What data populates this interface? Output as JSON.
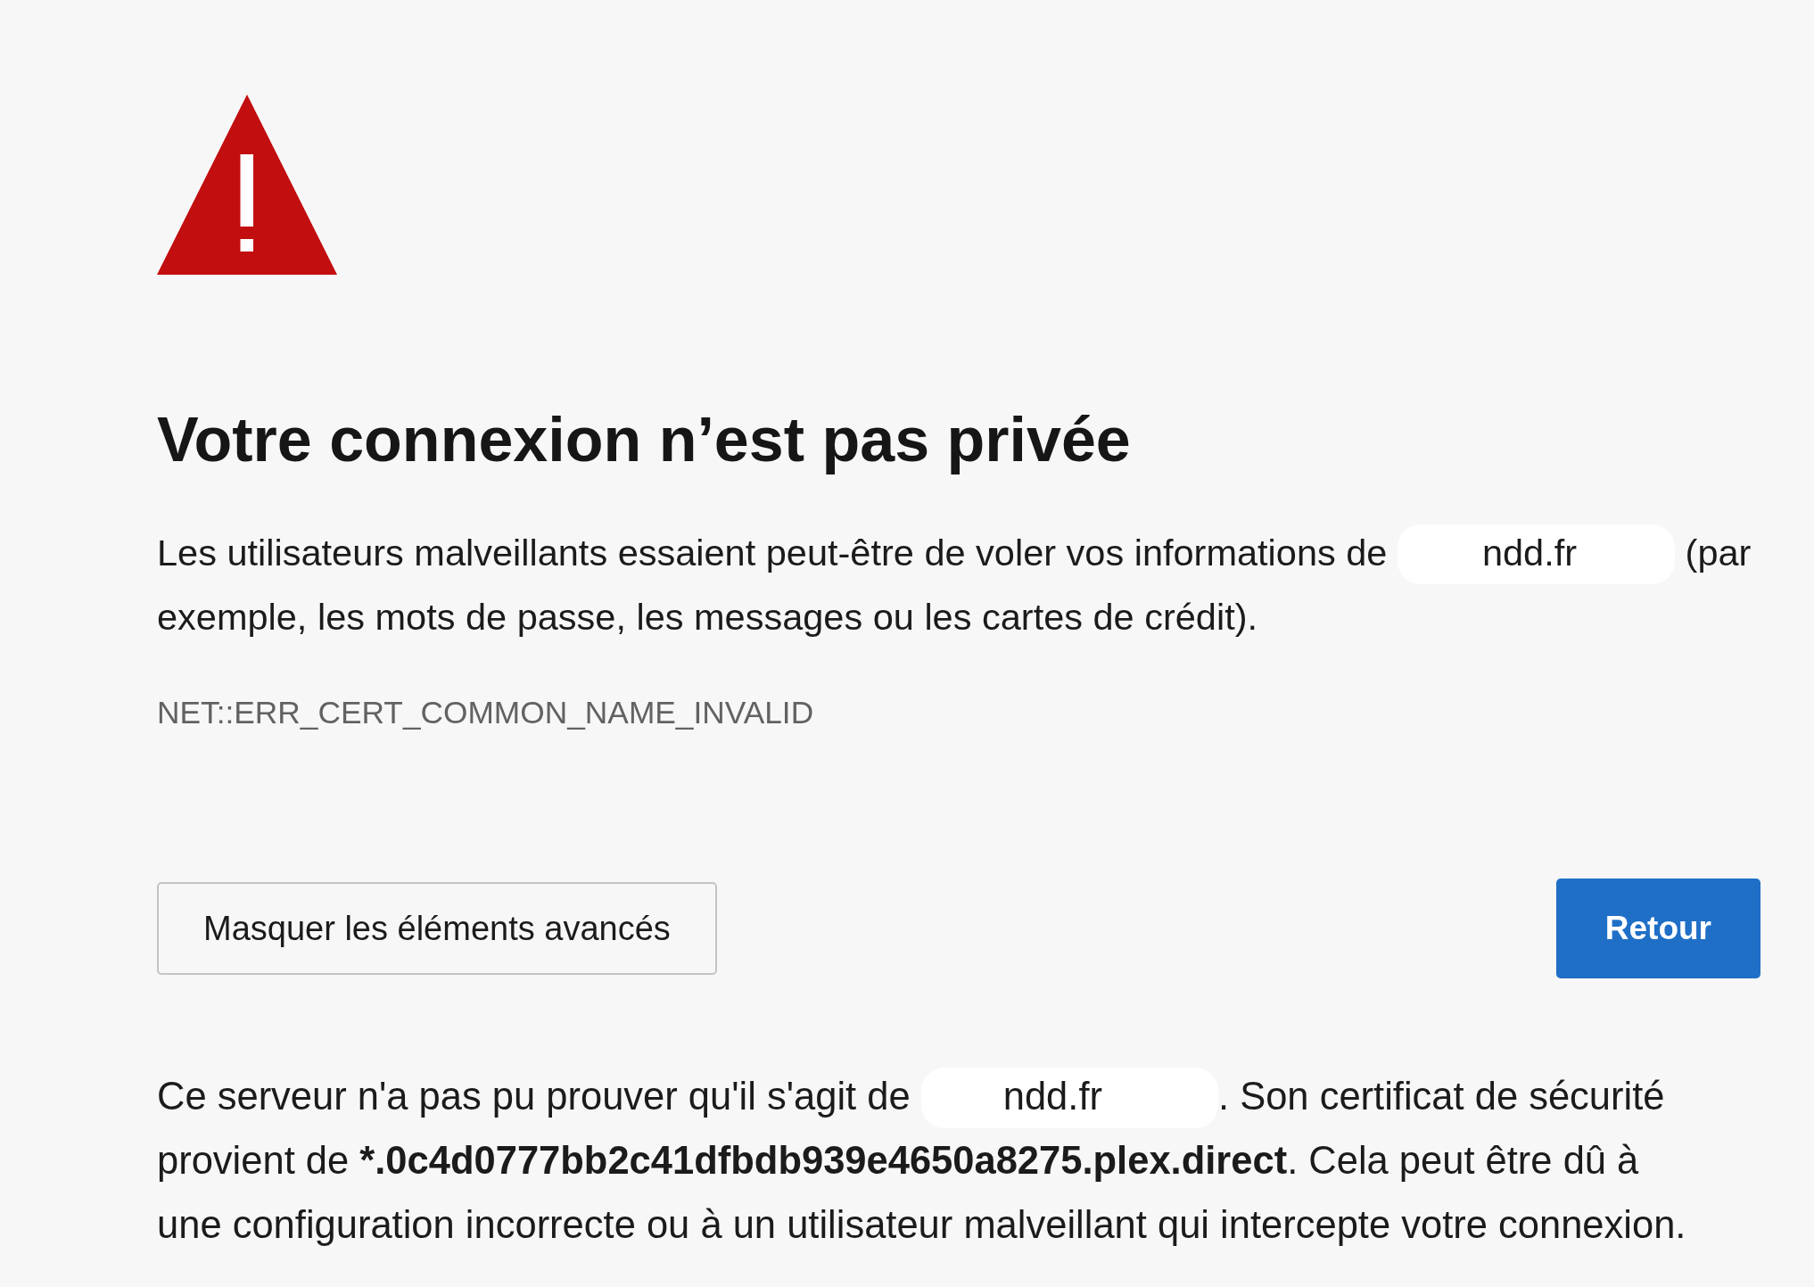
{
  "heading": "Votre connexion n’est pas privée",
  "intro": [
    {
      "kind": "plain",
      "text": "Les utilisateurs malveillants essaient peut-être de voler vos informations de "
    },
    {
      "kind": "redacted",
      "text": "ndd.fr"
    },
    {
      "kind": "plain",
      "text": " (par exemple, les mots de passe, les messages ou les cartes de crédit)."
    }
  ],
  "error_code": "NET::ERR_CERT_COMMON_NAME_INVALID",
  "buttons": [
    {
      "kind": "secondary",
      "label": "Masquer les éléments avancés"
    },
    {
      "kind": "primary",
      "label": "Retour"
    }
  ],
  "details": [
    {
      "kind": "plain",
      "text": "Ce serveur n'a pas pu prouver qu'il s'agit de "
    },
    {
      "kind": "redacted",
      "text": "ndd.fr"
    },
    {
      "kind": "plain",
      "text": ". Son certificat de sécurité provient de "
    },
    {
      "kind": "bold",
      "text": "*.0c4d0777bb2c41dfbdb939e4650a8275.plex.direct"
    },
    {
      "kind": "plain",
      "text": ". Cela peut être dû à une configuration incorrecte ou à un utilisateur malveillant qui intercepte votre connexion."
    }
  ]
}
